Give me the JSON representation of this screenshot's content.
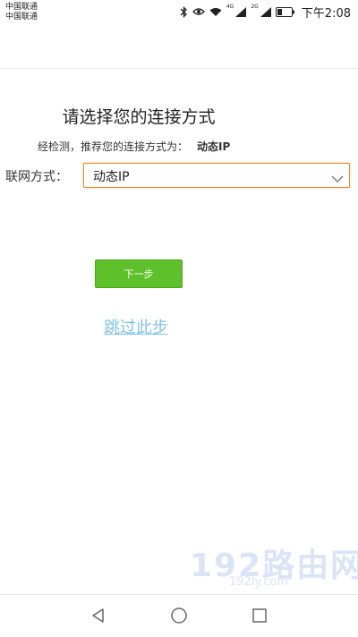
{
  "status_bar": {
    "carrier_1": "中国联通",
    "carrier_2": "中国联通",
    "net_1": "4G",
    "net_2": "2G",
    "time": "下午2:08"
  },
  "page": {
    "title": "请选择您的连接方式",
    "recommend_text": "经检测，推荐您的连接方式为：",
    "recommend_value": "动态IP",
    "connection_label": "联网方式：",
    "connection_selected": "动态IP",
    "next_button": "下一步",
    "skip_link": "跳过此步"
  },
  "watermark": {
    "main": "192路由网",
    "sub": "192ly.com"
  },
  "colors": {
    "button_green": "#5ec02a",
    "link_blue": "#7ec0e6",
    "select_border": "#e8892e"
  },
  "nav_icons": [
    "back-icon",
    "home-icon",
    "recents-icon"
  ]
}
